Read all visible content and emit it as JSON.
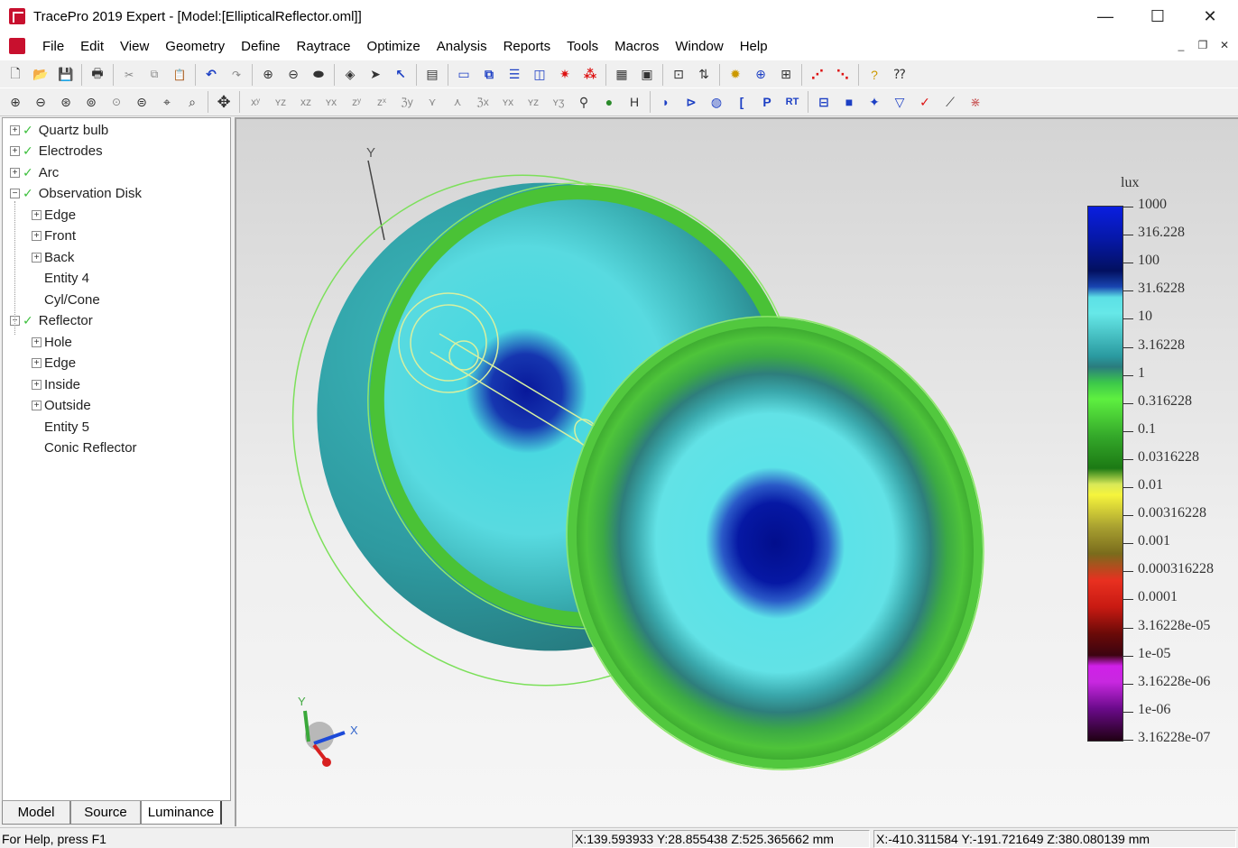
{
  "window": {
    "title": "TracePro 2019 Expert - [Model:[EllipticalReflector.oml]]",
    "minimize": "—",
    "maximize": "☐",
    "close": "✕"
  },
  "menu": [
    "File",
    "Edit",
    "View",
    "Geometry",
    "Define",
    "Raytrace",
    "Optimize",
    "Analysis",
    "Reports",
    "Tools",
    "Macros",
    "Window",
    "Help"
  ],
  "tree": [
    {
      "label": "Quartz bulb",
      "level": 0,
      "expander": "+",
      "check": true
    },
    {
      "label": "Electrodes",
      "level": 0,
      "expander": "+",
      "check": true
    },
    {
      "label": "Arc",
      "level": 0,
      "expander": "+",
      "check": true
    },
    {
      "label": "Observation Disk",
      "level": 0,
      "expander": "−",
      "check": true
    },
    {
      "label": "Edge",
      "level": 1,
      "expander": "+"
    },
    {
      "label": "Front",
      "level": 1,
      "expander": "+"
    },
    {
      "label": "Back",
      "level": 1,
      "expander": "+"
    },
    {
      "label": "Entity 4",
      "level": 1,
      "expander": ""
    },
    {
      "label": "Cyl/Cone",
      "level": 1,
      "expander": ""
    },
    {
      "label": "Reflector",
      "level": 0,
      "expander": "−",
      "check": true
    },
    {
      "label": "Hole",
      "level": 1,
      "expander": "+"
    },
    {
      "label": "Edge",
      "level": 1,
      "expander": "+"
    },
    {
      "label": "Inside",
      "level": 1,
      "expander": "+"
    },
    {
      "label": "Outside",
      "level": 1,
      "expander": "+"
    },
    {
      "label": "Entity 5",
      "level": 1,
      "expander": ""
    },
    {
      "label": "Conic Reflector",
      "level": 1,
      "expander": ""
    }
  ],
  "tabs": [
    "Model",
    "Source",
    "Luminance"
  ],
  "legend": {
    "unit": "lux",
    "labels": [
      "1000",
      "316.228",
      "100",
      "31.6228",
      "10",
      "3.16228",
      "1",
      "0.316228",
      "0.1",
      "0.0316228",
      "0.01",
      "0.00316228",
      "0.001",
      "0.000316228",
      "0.0001",
      "3.16228e-05",
      "1e-05",
      "3.16228e-06",
      "1e-06",
      "3.16228e-07"
    ]
  },
  "axes": {
    "y": "Y",
    "x": "X"
  },
  "status": {
    "help": "For Help, press F1",
    "coord1": "X:139.593933 Y:28.855438 Z:525.365662 mm",
    "coord2": "X:-410.311584 Y:-191.721649 Z:380.080139 mm"
  }
}
